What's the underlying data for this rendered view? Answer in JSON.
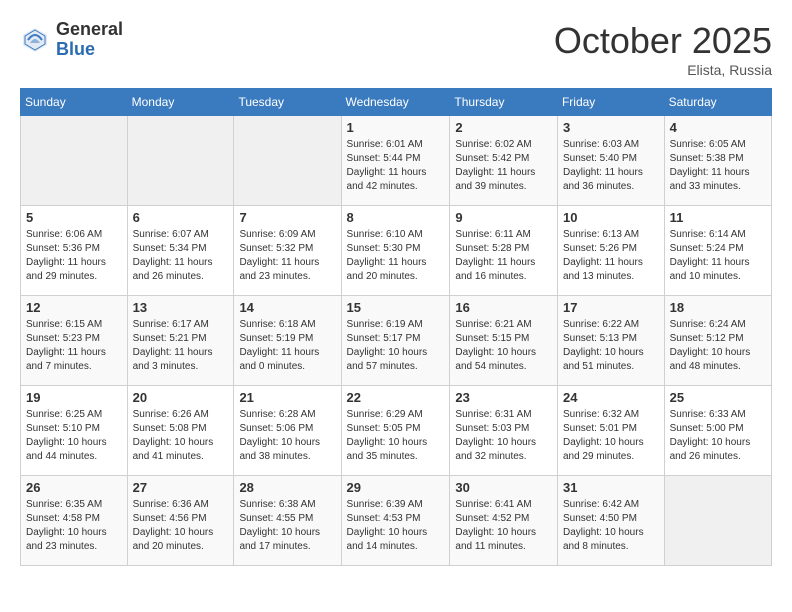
{
  "header": {
    "logo_general": "General",
    "logo_blue": "Blue",
    "month": "October 2025",
    "location": "Elista, Russia"
  },
  "days_of_week": [
    "Sunday",
    "Monday",
    "Tuesday",
    "Wednesday",
    "Thursday",
    "Friday",
    "Saturday"
  ],
  "weeks": [
    [
      {
        "day": "",
        "sunrise": "",
        "sunset": "",
        "daylight": ""
      },
      {
        "day": "",
        "sunrise": "",
        "sunset": "",
        "daylight": ""
      },
      {
        "day": "",
        "sunrise": "",
        "sunset": "",
        "daylight": ""
      },
      {
        "day": "1",
        "sunrise": "Sunrise: 6:01 AM",
        "sunset": "Sunset: 5:44 PM",
        "daylight": "Daylight: 11 hours and 42 minutes."
      },
      {
        "day": "2",
        "sunrise": "Sunrise: 6:02 AM",
        "sunset": "Sunset: 5:42 PM",
        "daylight": "Daylight: 11 hours and 39 minutes."
      },
      {
        "day": "3",
        "sunrise": "Sunrise: 6:03 AM",
        "sunset": "Sunset: 5:40 PM",
        "daylight": "Daylight: 11 hours and 36 minutes."
      },
      {
        "day": "4",
        "sunrise": "Sunrise: 6:05 AM",
        "sunset": "Sunset: 5:38 PM",
        "daylight": "Daylight: 11 hours and 33 minutes."
      }
    ],
    [
      {
        "day": "5",
        "sunrise": "Sunrise: 6:06 AM",
        "sunset": "Sunset: 5:36 PM",
        "daylight": "Daylight: 11 hours and 29 minutes."
      },
      {
        "day": "6",
        "sunrise": "Sunrise: 6:07 AM",
        "sunset": "Sunset: 5:34 PM",
        "daylight": "Daylight: 11 hours and 26 minutes."
      },
      {
        "day": "7",
        "sunrise": "Sunrise: 6:09 AM",
        "sunset": "Sunset: 5:32 PM",
        "daylight": "Daylight: 11 hours and 23 minutes."
      },
      {
        "day": "8",
        "sunrise": "Sunrise: 6:10 AM",
        "sunset": "Sunset: 5:30 PM",
        "daylight": "Daylight: 11 hours and 20 minutes."
      },
      {
        "day": "9",
        "sunrise": "Sunrise: 6:11 AM",
        "sunset": "Sunset: 5:28 PM",
        "daylight": "Daylight: 11 hours and 16 minutes."
      },
      {
        "day": "10",
        "sunrise": "Sunrise: 6:13 AM",
        "sunset": "Sunset: 5:26 PM",
        "daylight": "Daylight: 11 hours and 13 minutes."
      },
      {
        "day": "11",
        "sunrise": "Sunrise: 6:14 AM",
        "sunset": "Sunset: 5:24 PM",
        "daylight": "Daylight: 11 hours and 10 minutes."
      }
    ],
    [
      {
        "day": "12",
        "sunrise": "Sunrise: 6:15 AM",
        "sunset": "Sunset: 5:23 PM",
        "daylight": "Daylight: 11 hours and 7 minutes."
      },
      {
        "day": "13",
        "sunrise": "Sunrise: 6:17 AM",
        "sunset": "Sunset: 5:21 PM",
        "daylight": "Daylight: 11 hours and 3 minutes."
      },
      {
        "day": "14",
        "sunrise": "Sunrise: 6:18 AM",
        "sunset": "Sunset: 5:19 PM",
        "daylight": "Daylight: 11 hours and 0 minutes."
      },
      {
        "day": "15",
        "sunrise": "Sunrise: 6:19 AM",
        "sunset": "Sunset: 5:17 PM",
        "daylight": "Daylight: 10 hours and 57 minutes."
      },
      {
        "day": "16",
        "sunrise": "Sunrise: 6:21 AM",
        "sunset": "Sunset: 5:15 PM",
        "daylight": "Daylight: 10 hours and 54 minutes."
      },
      {
        "day": "17",
        "sunrise": "Sunrise: 6:22 AM",
        "sunset": "Sunset: 5:13 PM",
        "daylight": "Daylight: 10 hours and 51 minutes."
      },
      {
        "day": "18",
        "sunrise": "Sunrise: 6:24 AM",
        "sunset": "Sunset: 5:12 PM",
        "daylight": "Daylight: 10 hours and 48 minutes."
      }
    ],
    [
      {
        "day": "19",
        "sunrise": "Sunrise: 6:25 AM",
        "sunset": "Sunset: 5:10 PM",
        "daylight": "Daylight: 10 hours and 44 minutes."
      },
      {
        "day": "20",
        "sunrise": "Sunrise: 6:26 AM",
        "sunset": "Sunset: 5:08 PM",
        "daylight": "Daylight: 10 hours and 41 minutes."
      },
      {
        "day": "21",
        "sunrise": "Sunrise: 6:28 AM",
        "sunset": "Sunset: 5:06 PM",
        "daylight": "Daylight: 10 hours and 38 minutes."
      },
      {
        "day": "22",
        "sunrise": "Sunrise: 6:29 AM",
        "sunset": "Sunset: 5:05 PM",
        "daylight": "Daylight: 10 hours and 35 minutes."
      },
      {
        "day": "23",
        "sunrise": "Sunrise: 6:31 AM",
        "sunset": "Sunset: 5:03 PM",
        "daylight": "Daylight: 10 hours and 32 minutes."
      },
      {
        "day": "24",
        "sunrise": "Sunrise: 6:32 AM",
        "sunset": "Sunset: 5:01 PM",
        "daylight": "Daylight: 10 hours and 29 minutes."
      },
      {
        "day": "25",
        "sunrise": "Sunrise: 6:33 AM",
        "sunset": "Sunset: 5:00 PM",
        "daylight": "Daylight: 10 hours and 26 minutes."
      }
    ],
    [
      {
        "day": "26",
        "sunrise": "Sunrise: 6:35 AM",
        "sunset": "Sunset: 4:58 PM",
        "daylight": "Daylight: 10 hours and 23 minutes."
      },
      {
        "day": "27",
        "sunrise": "Sunrise: 6:36 AM",
        "sunset": "Sunset: 4:56 PM",
        "daylight": "Daylight: 10 hours and 20 minutes."
      },
      {
        "day": "28",
        "sunrise": "Sunrise: 6:38 AM",
        "sunset": "Sunset: 4:55 PM",
        "daylight": "Daylight: 10 hours and 17 minutes."
      },
      {
        "day": "29",
        "sunrise": "Sunrise: 6:39 AM",
        "sunset": "Sunset: 4:53 PM",
        "daylight": "Daylight: 10 hours and 14 minutes."
      },
      {
        "day": "30",
        "sunrise": "Sunrise: 6:41 AM",
        "sunset": "Sunset: 4:52 PM",
        "daylight": "Daylight: 10 hours and 11 minutes."
      },
      {
        "day": "31",
        "sunrise": "Sunrise: 6:42 AM",
        "sunset": "Sunset: 4:50 PM",
        "daylight": "Daylight: 10 hours and 8 minutes."
      },
      {
        "day": "",
        "sunrise": "",
        "sunset": "",
        "daylight": ""
      }
    ]
  ]
}
